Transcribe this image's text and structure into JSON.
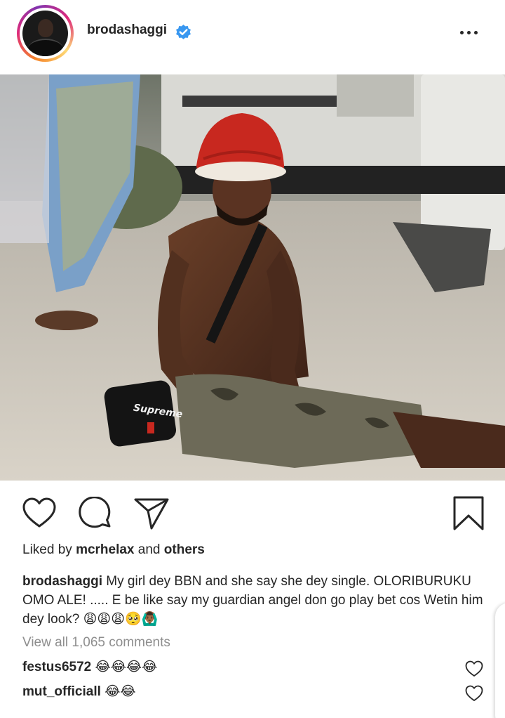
{
  "post": {
    "username": "brodashaggi",
    "verified_icon": "verified-badge-icon",
    "more_icon": "more-options-icon"
  },
  "photo": {
    "bag_brand": "Supreme"
  },
  "actions": {
    "like_icon": "heart-icon",
    "comment_icon": "comment-icon",
    "share_icon": "send-icon",
    "save_icon": "bookmark-icon"
  },
  "likes": {
    "prefix": "Liked by",
    "user": "mcrhelax",
    "joiner": "and",
    "others": "others"
  },
  "caption": {
    "username": "brodashaggi",
    "text": "My girl dey BBN and she say she dey single. OLORIBURUKU OMO ALE! ..... E be like say my guardian angel don go play bet cos Wetin him dey look? 😩😩😩🥺🙆🏾‍♂️"
  },
  "view_comments": "View all 1,065 comments",
  "comments": [
    {
      "username": "festus6572",
      "text": "😂😂😂😂"
    },
    {
      "username": "mut_officiall",
      "text": "😂😂"
    }
  ],
  "colors": {
    "text": "#262626",
    "muted": "#8e8e8e",
    "verified": "#3897f0",
    "hat_red": "#c8281f"
  }
}
